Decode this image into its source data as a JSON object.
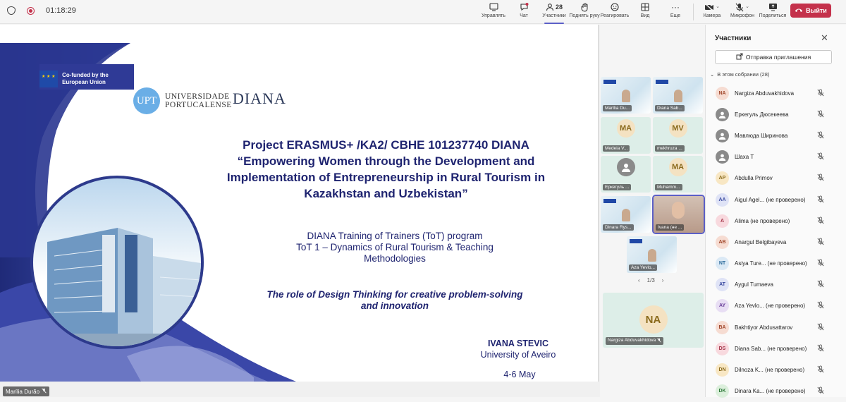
{
  "call": {
    "timer": "01:18:29",
    "leave_label": "Выйти"
  },
  "toolbar": {
    "items": [
      {
        "label": "Управлять",
        "icon": "manage-icon"
      },
      {
        "label": "Чат",
        "icon": "chat-icon"
      },
      {
        "label": "Участники",
        "icon": "people-icon",
        "count": "28"
      },
      {
        "label": "Поднять руку",
        "icon": "raise-hand-icon"
      },
      {
        "label": "Реагировать",
        "icon": "react-icon"
      },
      {
        "label": "Вид",
        "icon": "view-icon"
      },
      {
        "label": "Еще",
        "icon": "more-icon"
      },
      {
        "label": "Камера",
        "icon": "camera-off-icon"
      },
      {
        "label": "Микрофон",
        "icon": "mic-off-icon"
      },
      {
        "label": "Поделиться",
        "icon": "share-icon"
      }
    ]
  },
  "slide": {
    "eu_text": "Co-funded by the European Union",
    "upt_logo": "UPT",
    "upt_text_1": "UNIVERSIDADE",
    "upt_text_2": "PORTUCALENSE",
    "diana_logo": "DIANA",
    "title_line1": "Project ERASMUS+ /KA2/ CBHE 101237740 DIANA",
    "title_line2": "“Empowering Women through the Development and",
    "title_line3": "Implementation of Entrepreneurship in Rural Tourism in",
    "title_line4": "Kazakhstan and Uzbekistan”",
    "sub_line1": "DIANA Training of Trainers (ToT) program",
    "sub_line2": "ToT 1 – Dynamics of Rural Tourism & Teaching",
    "sub_line3": "Methodologies",
    "role_line1": "The role of Design Thinking for creative problem-solving",
    "role_line2": "and innovation",
    "author_name": "IVANA STEVIC",
    "author_org": "University of Aveiro",
    "date_line1": "4-6 May",
    "date_line2": "2026",
    "presenter": "Marília Durão"
  },
  "grid": {
    "tiles": [
      {
        "name": "Marília Du...",
        "type": "share"
      },
      {
        "name": "Diana Sab...",
        "type": "share"
      },
      {
        "name": "Medeia V...",
        "type": "avatar",
        "initials": "MA"
      },
      {
        "name": "mekhruza ...",
        "type": "avatar",
        "initials": "MV"
      },
      {
        "name": "Еркегуль ...",
        "type": "avatar-grey"
      },
      {
        "name": "Muhamm...",
        "type": "avatar",
        "initials": "MA"
      },
      {
        "name": "Dinara Rys...",
        "type": "share"
      },
      {
        "name": "Ivana (не ...",
        "type": "camera"
      },
      {
        "name": "Aza Yevlo...",
        "type": "share"
      }
    ],
    "pager": "1/3",
    "featured_name": "Nargiza Abduvakhidova",
    "featured_initials": "NA"
  },
  "panel": {
    "title": "Участники",
    "invite_label": "Отправка приглашения",
    "section_label": "В этом собрании (28)",
    "participants": [
      {
        "initials": "NA",
        "name": "Nargiza Abduvakhidova",
        "bg": "#f6dcd2",
        "fg": "#a0462a"
      },
      {
        "initials": "",
        "name": "Еркегуль Дюсекеева",
        "bg": "#8a8a8a",
        "fg": "#ffffff"
      },
      {
        "initials": "",
        "name": "Мавлюда Ширинова",
        "bg": "#8a8a8a",
        "fg": "#ffffff"
      },
      {
        "initials": "",
        "name": "Шаха Т",
        "bg": "#8a8a8a",
        "fg": "#ffffff"
      },
      {
        "initials": "AP",
        "name": "Abdulla Primov",
        "bg": "#f8e7c4",
        "fg": "#8a6a1c"
      },
      {
        "initials": "AA",
        "name": "Aigul Agel...  (не проверено)",
        "bg": "#dfe3f6",
        "fg": "#3a4aa0"
      },
      {
        "initials": "A",
        "name": "Alima (не проверено)",
        "bg": "#f8d9de",
        "fg": "#a33247"
      },
      {
        "initials": "AB",
        "name": "Anargul Belgibayeva",
        "bg": "#f6dcd2",
        "fg": "#a0462a"
      },
      {
        "initials": "NT",
        "name": "Asiya Ture...  (не проверено)",
        "bg": "#dbe9f5",
        "fg": "#2b6a9a"
      },
      {
        "initials": "AT",
        "name": "Aygul Tumaeva",
        "bg": "#dfe3f6",
        "fg": "#3a4aa0"
      },
      {
        "initials": "AY",
        "name": "Aza Yevlo...   (не проверено)",
        "bg": "#e8def4",
        "fg": "#6a3f9a"
      },
      {
        "initials": "BA",
        "name": "Bakhtiyor Abdusattarov",
        "bg": "#f6dcd2",
        "fg": "#a0462a"
      },
      {
        "initials": "DS",
        "name": "Diana Sab...   (не проверено)",
        "bg": "#f8d9de",
        "fg": "#a33247"
      },
      {
        "initials": "DN",
        "name": "Dilnoza K...   (не проверено)",
        "bg": "#f8e7c4",
        "fg": "#8a6a1c"
      },
      {
        "initials": "DK",
        "name": "Dinara Ka...   (не проверено)",
        "bg": "#dcefdc",
        "fg": "#2f7a3a"
      }
    ]
  }
}
